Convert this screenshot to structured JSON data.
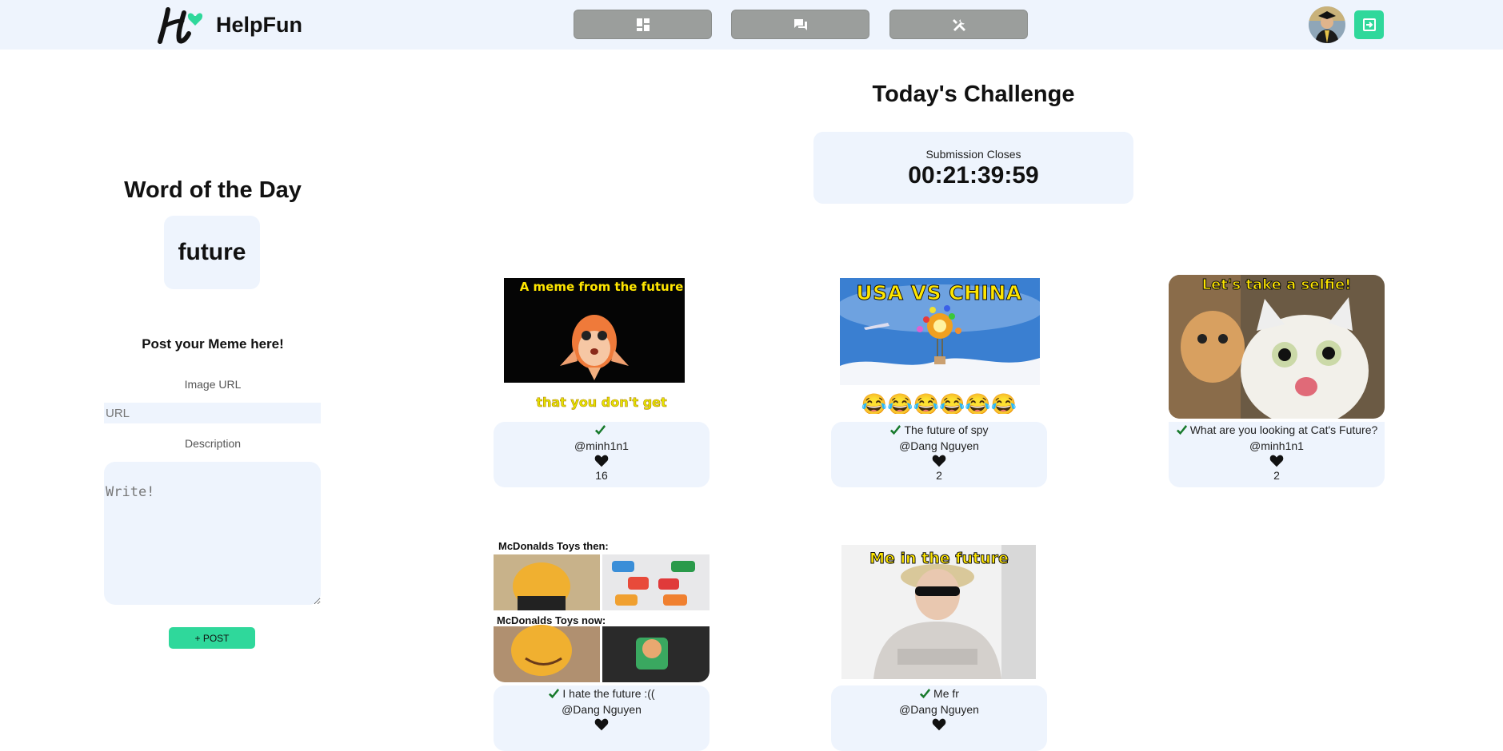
{
  "header": {
    "brand": "HelpFun",
    "nav": [
      {
        "icon": "dashboard-icon"
      },
      {
        "icon": "chat-icon"
      },
      {
        "icon": "tools-icon"
      }
    ],
    "logout_icon": "logout-icon"
  },
  "left_panel": {
    "word_title": "Word of the Day",
    "word": "future",
    "post_title": "Post your Meme here!",
    "image_url_label": "Image URL",
    "image_url_placeholder": "URL",
    "description_label": "Description",
    "description_placeholder": "Write!",
    "post_button": "+ POST"
  },
  "challenge": {
    "title": "Today's Challenge",
    "countdown_label": "Submission Closes",
    "countdown": "00:21:39:59"
  },
  "memes": [
    {
      "image_top_text": "A meme from the future",
      "image_bottom_text": "that you don't get",
      "description": "",
      "author": "@minh1n1",
      "likes": "16"
    },
    {
      "image_top_text": "USA VS CHINA",
      "image_bottom_text": "😂😂😂😂😂😂",
      "description": "The future of spy",
      "author": "@Dang Nguyen",
      "likes": "2"
    },
    {
      "image_top_text": "Let's take a selfie!",
      "description": "What are you looking at Cat's Future?",
      "author": "@minh1n1",
      "likes": "2"
    },
    {
      "image_top_text": "McDonalds Toys then:",
      "image_mid_text": "McDonalds Toys now:",
      "description": "I hate the future :((",
      "author": "@Dang Nguyen"
    },
    {
      "image_top_text": "Me in the future",
      "description": "Me fr",
      "author": "@Dang Nguyen"
    }
  ],
  "colors": {
    "accent": "#2fd89b",
    "panel": "#eef4fd",
    "nav": "#9b9e9c"
  }
}
